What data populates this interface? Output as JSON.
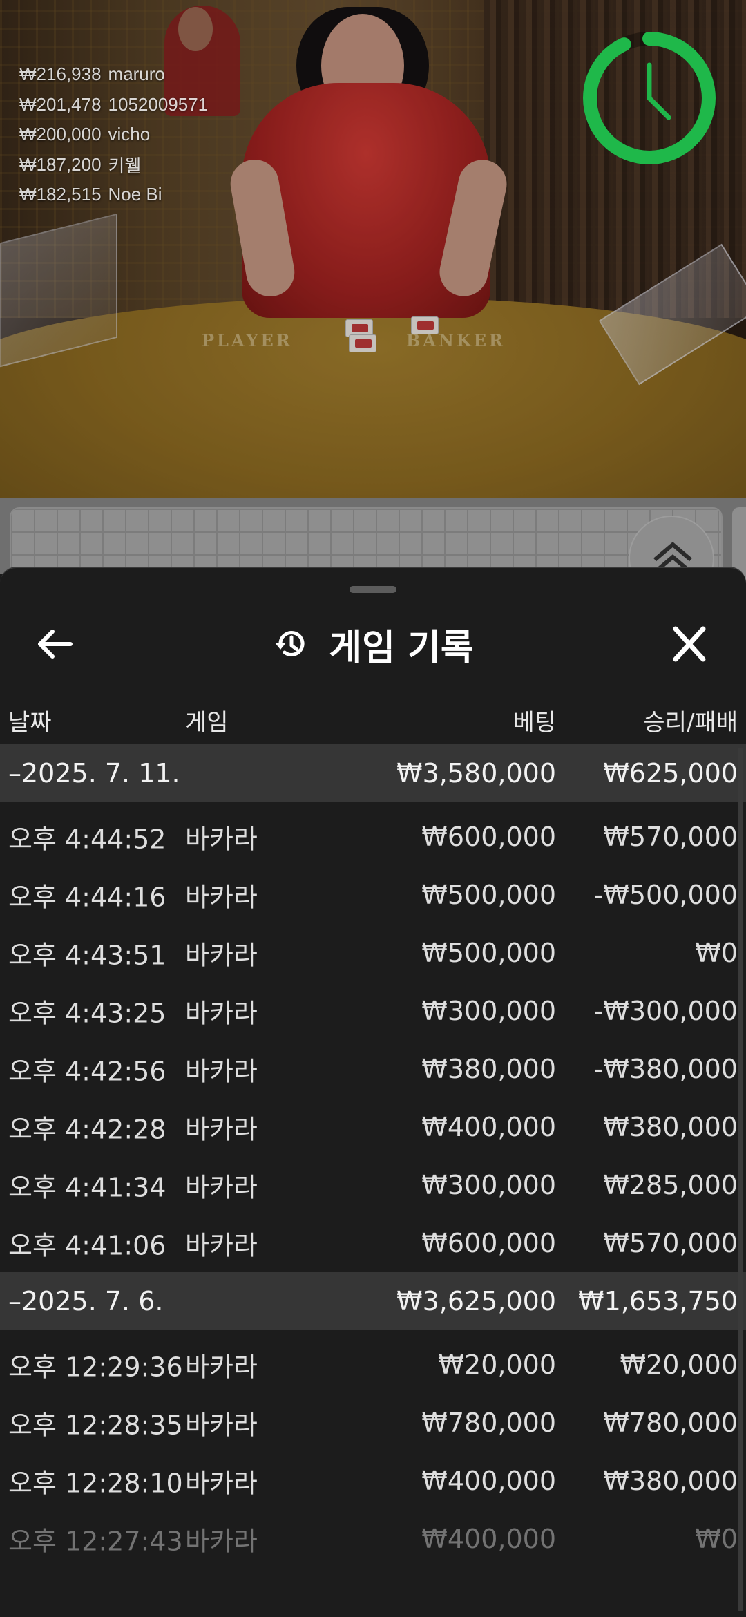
{
  "winners": [
    {
      "amount": "₩216,938",
      "name": "maruro"
    },
    {
      "amount": "₩201,478",
      "name": "1052009571"
    },
    {
      "amount": "₩200,000",
      "name": "vicho"
    },
    {
      "amount": "₩187,200",
      "name": "키웰"
    },
    {
      "amount": "₩182,515",
      "name": "Noe Bi"
    }
  ],
  "table": {
    "player_label": "PLAYER",
    "banker_label": "BANKER"
  },
  "timer": {
    "ring_color": "#1fb84a",
    "remaining_fraction": 0.93
  },
  "sheet": {
    "title": "게임 기록",
    "back_icon": "arrow-left-icon",
    "history_icon": "history-icon",
    "close_icon": "close-icon"
  },
  "columns": {
    "date": "날짜",
    "game": "게임",
    "bet": "베팅",
    "win_loss": "승리/패배"
  },
  "groups": [
    {
      "date": "–2025. 7. 11.",
      "bet_total": "₩3,580,000",
      "win_total": "₩625,000",
      "rows": [
        {
          "time": "오후 4:44:52",
          "game": "바카라",
          "bet": "₩600,000",
          "win": "₩570,000"
        },
        {
          "time": "오후 4:44:16",
          "game": "바카라",
          "bet": "₩500,000",
          "win": "-₩500,000"
        },
        {
          "time": "오후 4:43:51",
          "game": "바카라",
          "bet": "₩500,000",
          "win": "₩0"
        },
        {
          "time": "오후 4:43:25",
          "game": "바카라",
          "bet": "₩300,000",
          "win": "-₩300,000"
        },
        {
          "time": "오후 4:42:56",
          "game": "바카라",
          "bet": "₩380,000",
          "win": "-₩380,000"
        },
        {
          "time": "오후 4:42:28",
          "game": "바카라",
          "bet": "₩400,000",
          "win": "₩380,000"
        },
        {
          "time": "오후 4:41:34",
          "game": "바카라",
          "bet": "₩300,000",
          "win": "₩285,000"
        },
        {
          "time": "오후 4:41:06",
          "game": "바카라",
          "bet": "₩600,000",
          "win": "₩570,000"
        }
      ]
    },
    {
      "date": "–2025. 7. 6.",
      "bet_total": "₩3,625,000",
      "win_total": "₩1,653,750",
      "rows": [
        {
          "time": "오후 12:29:36",
          "game": "바카라",
          "bet": "₩20,000",
          "win": "₩20,000"
        },
        {
          "time": "오후 12:28:35",
          "game": "바카라",
          "bet": "₩780,000",
          "win": "₩780,000"
        },
        {
          "time": "오후 12:28:10",
          "game": "바카라",
          "bet": "₩400,000",
          "win": "₩380,000"
        },
        {
          "time": "오후 12:27:43",
          "game": "바카라",
          "bet": "₩400,000",
          "win": "₩0"
        }
      ]
    }
  ],
  "colors": {
    "sheet_bg": "#1c1c1c",
    "group_bg": "#363636",
    "text": "#dedede"
  }
}
